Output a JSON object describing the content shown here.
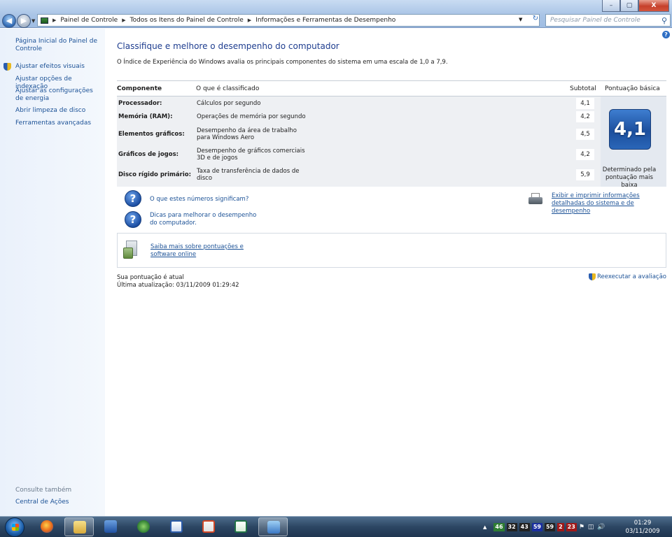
{
  "window": {
    "minimize_glyph": "–",
    "maximize_glyph": "▢",
    "close_glyph": "X"
  },
  "address_bar": {
    "crumbs": [
      "Painel de Controle",
      "Todos os Itens do Painel de Controle",
      "Informações e Ferramentas de Desempenho"
    ],
    "search_placeholder": "Pesquisar Painel de Controle"
  },
  "left_pane": {
    "home_link": "Página Inicial do Painel de Controle",
    "links": [
      "Ajustar efeitos visuais",
      "Ajustar opções de indexação",
      "Ajustar as configurações de energia",
      "Abrir limpeza de disco",
      "Ferramentas avançadas"
    ],
    "see_also_label": "Consulte também",
    "see_also_links": [
      "Central de Ações"
    ]
  },
  "main": {
    "title": "Classifique e melhore o desempenho do computador",
    "description": "O Índice de Experiência do Windows avalia os principais componentes do sistema em uma escala de 1,0 a 7,9.",
    "table": {
      "headers": {
        "component": "Componente",
        "rated": "O que é classificado",
        "subtotal": "Subtotal",
        "base_score": "Pontuação básica"
      },
      "rows": [
        {
          "component": "Processador:",
          "rated": "Cálculos por segundo",
          "subtotal": "4,1"
        },
        {
          "component": "Memória (RAM):",
          "rated": "Operações de memória por segundo",
          "subtotal": "4,2"
        },
        {
          "component": "Elementos gráficos:",
          "rated": "Desempenho da área de trabalho para Windows Aero",
          "subtotal": "4,5"
        },
        {
          "component": "Gráficos de jogos:",
          "rated": "Desempenho de gráficos comerciais 3D e de jogos",
          "subtotal": "4,2"
        },
        {
          "component": "Disco rígido primário:",
          "rated": "Taxa de transferência de dados de disco",
          "subtotal": "5,9"
        }
      ],
      "base_score": "4,1",
      "base_score_note": "Determinado pela pontuação mais baixa"
    },
    "help_links": [
      "O que estes números significam?",
      "Dicas para melhorar o desempenho do computador."
    ],
    "print_link": "Exibir e imprimir informações detalhadas do sistema e de desempenho",
    "learn_more_link": "Saiba mais sobre pontuações e software online",
    "status_current": "Sua pontuação é atual",
    "status_last_update": "Última atualização: 03/11/2009 01:29:42",
    "rerun_link": "Reexecutar a avaliação"
  },
  "taskbar": {
    "tray_numbers": [
      {
        "text": "46",
        "bg": "#2e7d32"
      },
      {
        "text": "32",
        "bg": "#222222"
      },
      {
        "text": "43",
        "bg": "#222222"
      },
      {
        "text": "59",
        "bg": "#1a2fa0"
      },
      {
        "text": "59",
        "bg": "#222222"
      },
      {
        "text": "2",
        "bg": "#a01818"
      },
      {
        "text": "23",
        "bg": "#a01818"
      }
    ],
    "clock_time": "01:29",
    "clock_date": "03/11/2009"
  }
}
